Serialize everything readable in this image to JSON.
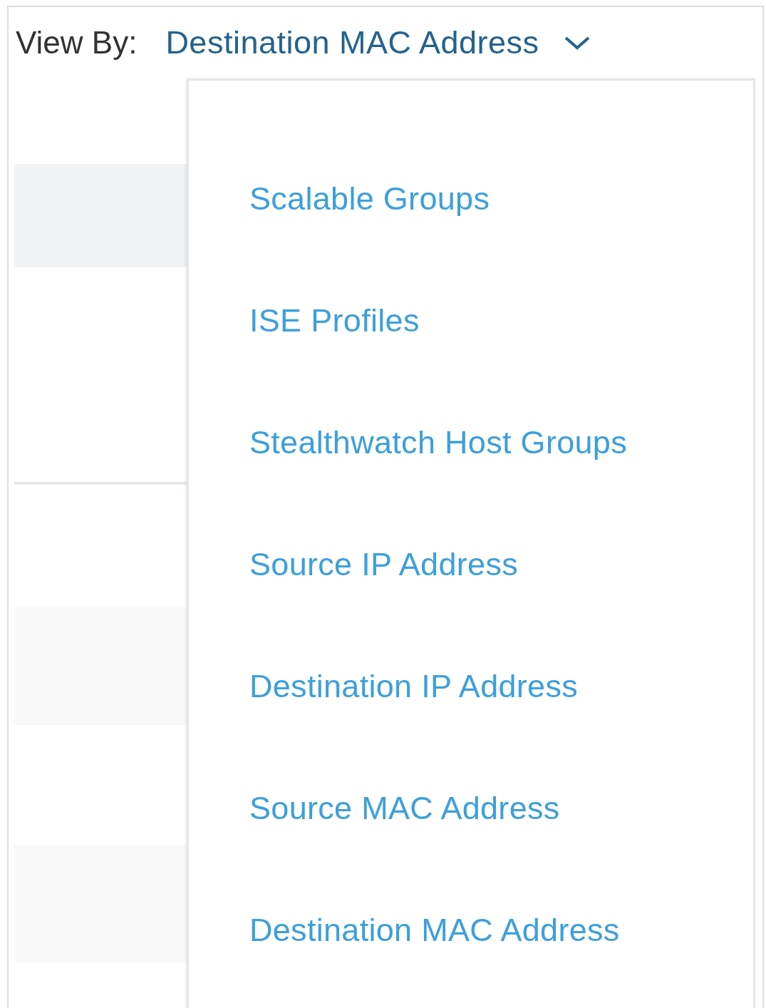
{
  "view_by": {
    "label": "View By:",
    "value": "Destination MAC Address"
  },
  "dropdown": {
    "options": [
      {
        "label": "Scalable Groups"
      },
      {
        "label": "ISE Profiles"
      },
      {
        "label": "Stealthwatch Host Groups"
      },
      {
        "label": "Source IP Address"
      },
      {
        "label": "Destination IP Address"
      },
      {
        "label": "Source MAC Address"
      },
      {
        "label": "Destination MAC Address"
      }
    ]
  }
}
